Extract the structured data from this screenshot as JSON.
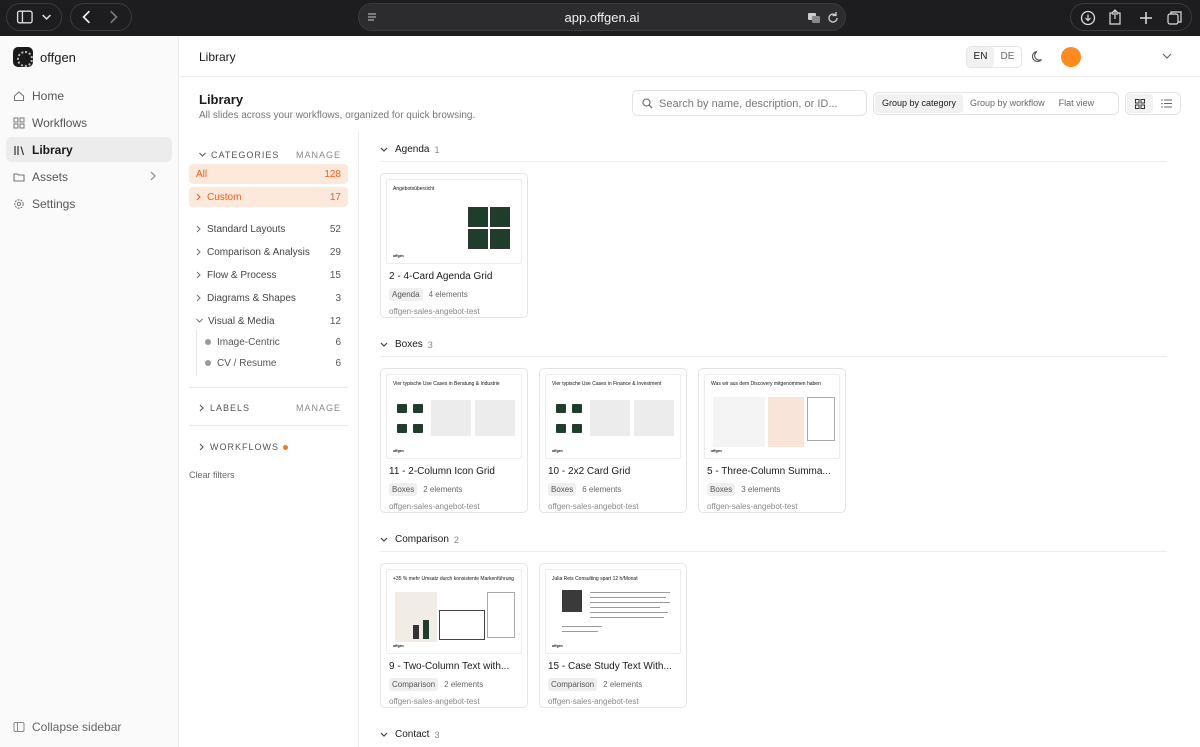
{
  "browser": {
    "url": "app.offgen.ai"
  },
  "sidebar": {
    "brand": "offgen",
    "items": [
      {
        "label": "Home",
        "icon": "home-icon"
      },
      {
        "label": "Workflows",
        "icon": "grid-icon"
      },
      {
        "label": "Library",
        "icon": "library-icon"
      },
      {
        "label": "Assets",
        "icon": "folder-icon"
      },
      {
        "label": "Settings",
        "icon": "gear-icon"
      }
    ],
    "collapse_label": "Collapse sidebar"
  },
  "header": {
    "breadcrumb": "Library",
    "lang_en": "EN",
    "lang_de": "DE"
  },
  "page": {
    "title": "Library",
    "subtitle": "All slides across your workflows, organized for quick browsing.",
    "search_placeholder": "Search by name, description, or ID...",
    "group_by_category": "Group by category",
    "group_by_workflow": "Group by workflow",
    "flat_view": "Flat view"
  },
  "filters": {
    "categories_label": "CATEGORIES",
    "manage_label": "MANAGE",
    "rows": [
      {
        "label": "All",
        "count": "128"
      },
      {
        "label": "Custom",
        "count": "17"
      },
      {
        "label": "Standard Layouts",
        "count": "52"
      },
      {
        "label": "Comparison & Analysis",
        "count": "29"
      },
      {
        "label": "Flow & Process",
        "count": "15"
      },
      {
        "label": "Diagrams & Shapes",
        "count": "3"
      },
      {
        "label": "Visual & Media",
        "count": "12"
      }
    ],
    "subs": [
      {
        "label": "Image-Centric",
        "count": "6"
      },
      {
        "label": "CV / Resume",
        "count": "6"
      }
    ],
    "labels_label": "LABELS",
    "workflows_label": "WORKFLOWS",
    "clear_label": "Clear filters"
  },
  "sections": [
    {
      "name": "Agenda",
      "count": "1"
    },
    {
      "name": "Boxes",
      "count": "3"
    },
    {
      "name": "Comparison",
      "count": "2"
    },
    {
      "name": "Contact",
      "count": "3"
    }
  ],
  "cards": [
    {
      "title": "2 - 4-Card Agenda Grid",
      "tag": "Agenda",
      "elements": "4 elements",
      "workflow": "offgen-sales-angebot-test",
      "thumb_title": "Angebotsübersicht",
      "thumb_footer": "offgen"
    },
    {
      "title": "11 - 2-Column Icon Grid",
      "tag": "Boxes",
      "elements": "2 elements",
      "workflow": "offgen-sales-angebot-test",
      "thumb_title": "Vier typische Use Cases in Beratung & Industrie",
      "thumb_footer": "offgen"
    },
    {
      "title": "10 - 2x2 Card Grid",
      "tag": "Boxes",
      "elements": "6 elements",
      "workflow": "offgen-sales-angebot-test",
      "thumb_title": "Vier typische Use Cases in Finance & Investment",
      "thumb_footer": "offgen"
    },
    {
      "title": "5 - Three-Column Summa...",
      "tag": "Boxes",
      "elements": "3 elements",
      "workflow": "offgen-sales-angebot-test",
      "thumb_title": "Was wir aus dem Discovery mitgenommen haben",
      "thumb_footer": "offgen"
    },
    {
      "title": "9 - Two-Column Text with...",
      "tag": "Comparison",
      "elements": "2 elements",
      "workflow": "offgen-sales-angebot-test",
      "thumb_title": "+35 % mehr Umsatz durch konsistente Markenführung",
      "thumb_footer": "offgen"
    },
    {
      "title": "15 - Case Study Text With...",
      "tag": "Comparison",
      "elements": "2 elements",
      "workflow": "offgen-sales-angebot-test",
      "thumb_title": "Julia Reis Consulting spart 12 h/Monat",
      "thumb_footer": "offgen"
    }
  ],
  "colors": {
    "accent": "#e8621c",
    "avatar": "#ff8a1f",
    "slide_green": "#1f3d2b"
  }
}
